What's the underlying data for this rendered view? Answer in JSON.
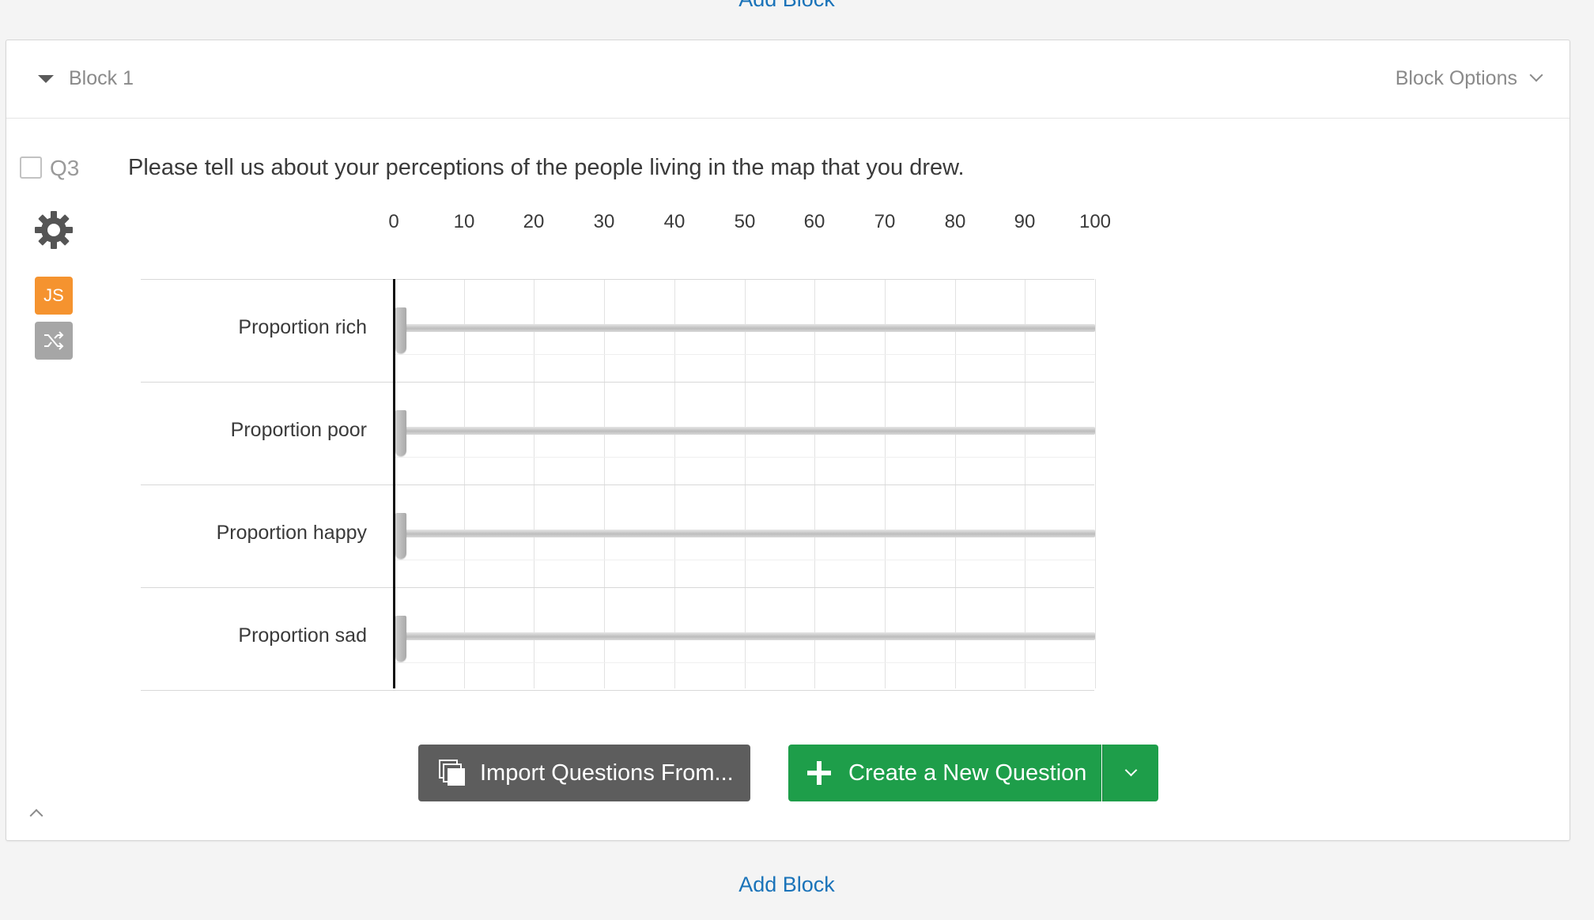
{
  "page": {
    "top_add_block": "Add Block",
    "bottom_add_block": "Add Block"
  },
  "block": {
    "title": "Block 1",
    "options_label": "Block Options"
  },
  "question": {
    "number": "Q3",
    "text": "Please tell us about your perceptions of the people living in the map that you drew.",
    "js_badge": "JS",
    "icons": [
      "gear-icon",
      "javascript-icon",
      "shuffle-icon"
    ],
    "scale": {
      "min": 0,
      "max": 100,
      "ticks": [
        "0",
        "10",
        "20",
        "30",
        "40",
        "50",
        "60",
        "70",
        "80",
        "90",
        "100"
      ]
    },
    "rows": [
      {
        "label": "Proportion rich",
        "value": 0
      },
      {
        "label": "Proportion poor",
        "value": 0
      },
      {
        "label": "Proportion happy",
        "value": 0
      },
      {
        "label": "Proportion sad",
        "value": 0
      }
    ]
  },
  "buttons": {
    "import_label": "Import Questions From...",
    "create_label": "Create a New Question"
  },
  "colors": {
    "link": "#1a73b9",
    "js_badge": "#f5932f",
    "create_button": "#1e9e4a",
    "import_button": "#5d5d5d"
  }
}
